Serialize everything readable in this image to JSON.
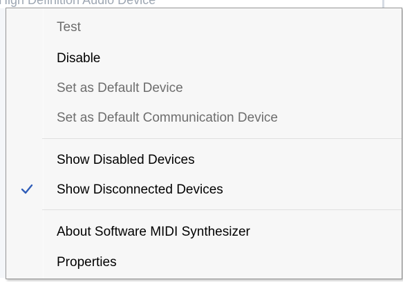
{
  "background": {
    "partial_text": "High Definition Audio Device"
  },
  "menu": {
    "items": {
      "test": "Test",
      "disable": "Disable",
      "set_default_device": "Set as Default Device",
      "set_default_communication": "Set as Default Communication Device",
      "show_disabled": "Show Disabled Devices",
      "show_disconnected": "Show Disconnected Devices",
      "about_midi": "About Software MIDI Synthesizer",
      "properties": "Properties"
    },
    "checked": {
      "show_disconnected": true
    },
    "icons": {
      "check": "check-icon"
    },
    "colors": {
      "enabled_text": "#000000",
      "disabled_text": "#6d6d6d",
      "check": "#2f5db8",
      "menu_background": "#f7f7f7",
      "menu_border": "#979797"
    }
  }
}
